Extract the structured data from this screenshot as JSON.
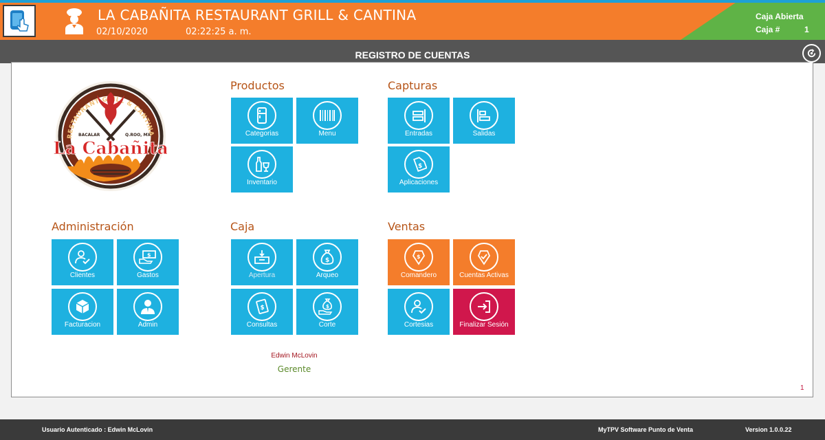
{
  "header": {
    "title": "LA CABAÑITA RESTAURANT GRILL & CANTINA",
    "date": "02/10/2020",
    "time": "02:22:25 a. m.",
    "caja_status": "Caja Abierta",
    "caja_label": "Caja #",
    "caja_number": "1"
  },
  "subbar": {
    "title": "REGISTRO DE CUENTAS"
  },
  "logo": {
    "arc_text": "RESTAURANT GRILL & CANTINA",
    "left_text": "BACALAR",
    "right_text": "Q.ROO, MX",
    "name": "La Cabañita"
  },
  "sections": {
    "productos": {
      "title": "Productos",
      "tiles": [
        {
          "label": "Categorias",
          "icon": "fridge-icon"
        },
        {
          "label": "Menu",
          "icon": "barcode-icon"
        },
        {
          "label": "Inventario",
          "icon": "bottle-glass-icon"
        }
      ]
    },
    "capturas": {
      "title": "Capturas",
      "tiles": [
        {
          "label": "Entradas",
          "icon": "align-right-icon"
        },
        {
          "label": "Salidas",
          "icon": "align-left-icon"
        },
        {
          "label": "Aplicaciones",
          "icon": "price-tag-icon"
        }
      ]
    },
    "administracion": {
      "title": "Administración",
      "tiles": [
        {
          "label": "Clientes",
          "icon": "user-check-icon"
        },
        {
          "label": "Gastos",
          "icon": "cash-hand-icon"
        },
        {
          "label": "Facturacion",
          "icon": "box-icon"
        },
        {
          "label": "Admin",
          "icon": "admin-user-icon"
        }
      ]
    },
    "caja": {
      "title": "Caja",
      "tiles": [
        {
          "label": "Apertura",
          "icon": "cash-drawer-icon"
        },
        {
          "label": "Arqueo",
          "icon": "money-bag-icon"
        },
        {
          "label": "Consultas",
          "icon": "bills-icon"
        },
        {
          "label": "Corte",
          "icon": "money-bag-hand-icon"
        }
      ]
    },
    "ventas": {
      "title": "Ventas",
      "tiles": [
        {
          "label": "Comandero",
          "icon": "ticket-icon"
        },
        {
          "label": "Cuentas Activas",
          "icon": "ticket-check-icon"
        },
        {
          "label": "Cortesias",
          "icon": "user-check-icon"
        },
        {
          "label": "Finalizar Sesión",
          "icon": "sign-out-icon"
        }
      ]
    }
  },
  "user": {
    "name": "Edwin McLovin",
    "role": "Gerente"
  },
  "page_number": "1",
  "footer": {
    "user": "Usuario Autenticado : Edwin McLovin",
    "software": "MyTPV Software Punto de Venta",
    "version": "Version 1.0.0.22"
  },
  "colors": {
    "header_orange": "#f47d2b",
    "header_green": "#5fb346",
    "tile_blue": "#1eb1e0",
    "tile_red": "#d0174c",
    "section_title": "#b65417"
  }
}
